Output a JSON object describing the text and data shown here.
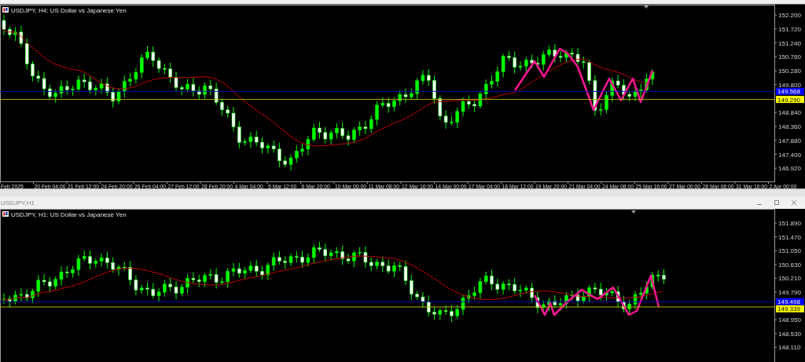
{
  "charts": [
    {
      "title": "USDJPY, H4:  US Dollar vs Japanese Yen",
      "price_labels": [
        "152.200",
        "151.720",
        "151.240",
        "150.760",
        "150.280",
        "149.800",
        "148.840",
        "148.360",
        "147.880",
        "147.400",
        "146.920"
      ],
      "lines": [
        {
          "label": "149.568",
          "color": "#0000ff"
        },
        {
          "label": "149.290",
          "color": "#ffff00"
        }
      ],
      "time_labels": [
        "Feb 2025",
        "20 Feb 04:00",
        "21 Feb 12:00",
        "24 Feb 20:00",
        "26 Feb 04:00",
        "27 Feb 12:00",
        "28 Feb 20:00",
        "4 Mar 04:00",
        "5 Mar 12:00",
        "6 Mar 20:00",
        "10 Mar 00:00",
        "11 Mar 08:00",
        "12 Mar 16:00",
        "14 Mar 00:00",
        "17 Mar 04:00",
        "18 Mar 12:00",
        "19 Mar 20:00",
        "21 Mar 04:00",
        "24 Mar 08:00",
        "25 Mar 16:00",
        "27 Mar 00:00",
        "28 Mar 08:00",
        "31 Mar 16:00",
        "2 Apr 00:00"
      ]
    },
    {
      "window_title": "USDJPY,H1",
      "title": "USDJPY, H1:  US Dollar vs Japanese Yen",
      "price_labels": [
        "151.890",
        "151.470",
        "151.050",
        "150.630",
        "150.210",
        "149.790",
        "148.950",
        "148.530",
        "148.110"
      ],
      "lines": [
        {
          "label": "149.498",
          "color": "#0000ff"
        },
        {
          "label": "149.339",
          "color": "#ffff00"
        }
      ]
    }
  ]
}
